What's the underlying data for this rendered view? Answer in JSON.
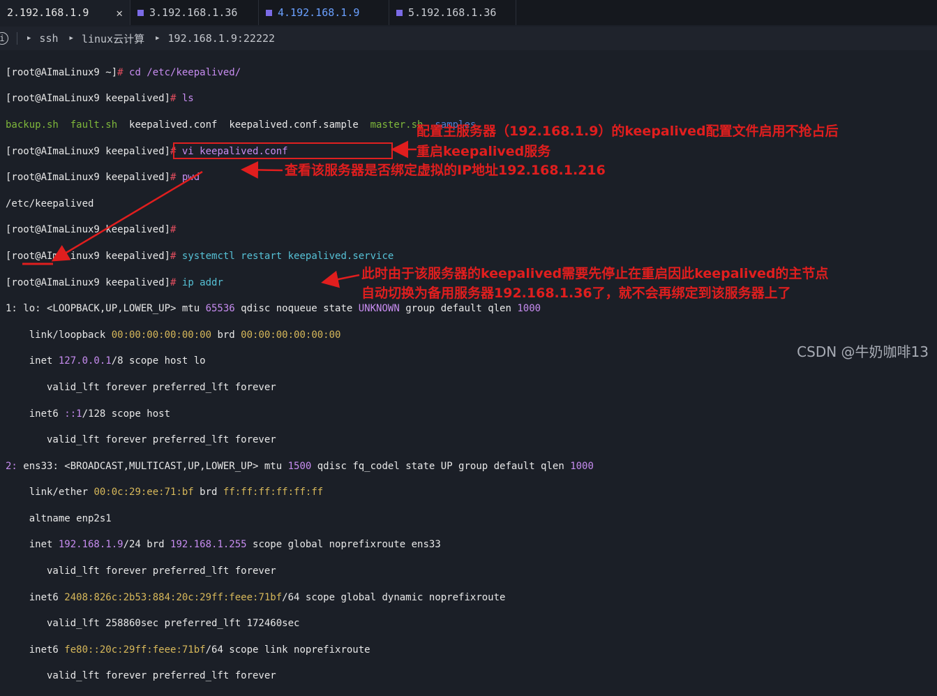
{
  "tabs": [
    {
      "label": "2.192.168.1.9",
      "active": true
    },
    {
      "label": "3.192.168.1.36"
    },
    {
      "label": "4.192.168.1.9"
    },
    {
      "label": "5.192.168.1.36"
    }
  ],
  "tab_close": "✕",
  "breadcrumb": {
    "items": [
      "ssh",
      "linux云计算",
      "192.168.1.9:22222"
    ]
  },
  "terminal": {
    "l1": {
      "p": "[root@AImaLinux9 ~]",
      "h": "#",
      "c": " cd /etc/keepalived/"
    },
    "l2": {
      "p": "[root@AImaLinux9 keepalived]",
      "h": "#",
      "c": " ls"
    },
    "l3": {
      "a": "backup.sh",
      "b": "fault.sh",
      "c": "keepalived.conf",
      "d": "keepalived.conf.sample",
      "e": "master.sh",
      "f": "samples"
    },
    "l4": {
      "p": "[root@AImaLinux9 keepalived]",
      "h": "#",
      "c": " vi keepalived.conf"
    },
    "l5": {
      "p": "[root@AImaLinux9 keepalived]",
      "h": "#",
      "c": " pwd"
    },
    "l6": "/etc/keepalived",
    "l7": {
      "p": "[root@AImaLinux9 keepalived]",
      "h": "#"
    },
    "l8": {
      "p": "[root@AImaLinux9 keepalived]",
      "h": "#",
      "c": "systemctl restart keepalived.service"
    },
    "l9": {
      "p": "[root@AImaLinux9 keepalived]",
      "h": "#",
      "c": "ip addr"
    },
    "l10": {
      "a": "1: lo: <LOOPBACK,UP,LOWER_UP> mtu ",
      "b": "65536",
      "c": " qdisc noqueue state ",
      "d": "UNKNOWN",
      "e": " group default qlen ",
      "f": "1000"
    },
    "l11": {
      "a": "    link/loopback ",
      "b": "00:00:00:00:00:00",
      "c": " brd ",
      "d": "00:00:00:00:00:00"
    },
    "l12": {
      "a": "    inet ",
      "b": "127.0.0.1",
      "c": "/8 scope host lo"
    },
    "l13": "       valid_lft forever preferred_lft forever",
    "l14": {
      "a": "    inet6 ",
      "b": "::1",
      "c": "/128 scope host"
    },
    "l15": "       valid_lft forever preferred_lft forever",
    "l16": {
      "a": "2: ",
      "b": "ens33:",
      "c": " <BROADCAST,MULTICAST,UP,LOWER_UP> mtu ",
      "d": "1500",
      "e": " qdisc fq_codel state UP group default qlen ",
      "f": "1000"
    },
    "l17": {
      "a": "    link/ether ",
      "b": "00:0c:29:ee:71:bf",
      "c": " brd ",
      "d": "ff:ff:ff:ff:ff:ff"
    },
    "l18": "    altname enp2s1",
    "l19": {
      "a": "    inet ",
      "b": "192.168.1.9",
      "c": "/24 brd ",
      "d": "192.168.1.255",
      "e": " scope global noprefixroute ens33"
    },
    "l20": "       valid_lft forever preferred_lft forever",
    "l21": {
      "a": "    inet6 ",
      "b": "2408:826c:2b53:884:20c:29ff:feee:71bf",
      "c": "/64 scope global dynamic noprefixroute"
    },
    "l22": "       valid_lft 258860sec preferred_lft 172460sec",
    "l23": {
      "a": "    inet6 ",
      "b": "fe80::20c:29ff:feee:71bf",
      "c": "/64 scope link noprefixroute"
    },
    "l24": "       valid_lft forever preferred_lft forever"
  },
  "annotations": {
    "a1_line1": "配置主服务器（192.168.1.9）的keepalived配置文件启用不抢占后",
    "a1_line2": "重启keepalived服务",
    "a2": "查看该服务器是否绑定虚拟的IP地址192.168.1.216",
    "a3_line1": "此时由于该服务器的keepalived需要先停止在重启因此keepalived的主节点",
    "a3_line2": "自动切换为备用服务器192.168.1.36了，就不会再绑定到该服务器上了"
  },
  "watermark": "CSDN @牛奶咖啡13",
  "colors": {
    "annotation": "#e01e1e",
    "background": "#1b1f27"
  }
}
